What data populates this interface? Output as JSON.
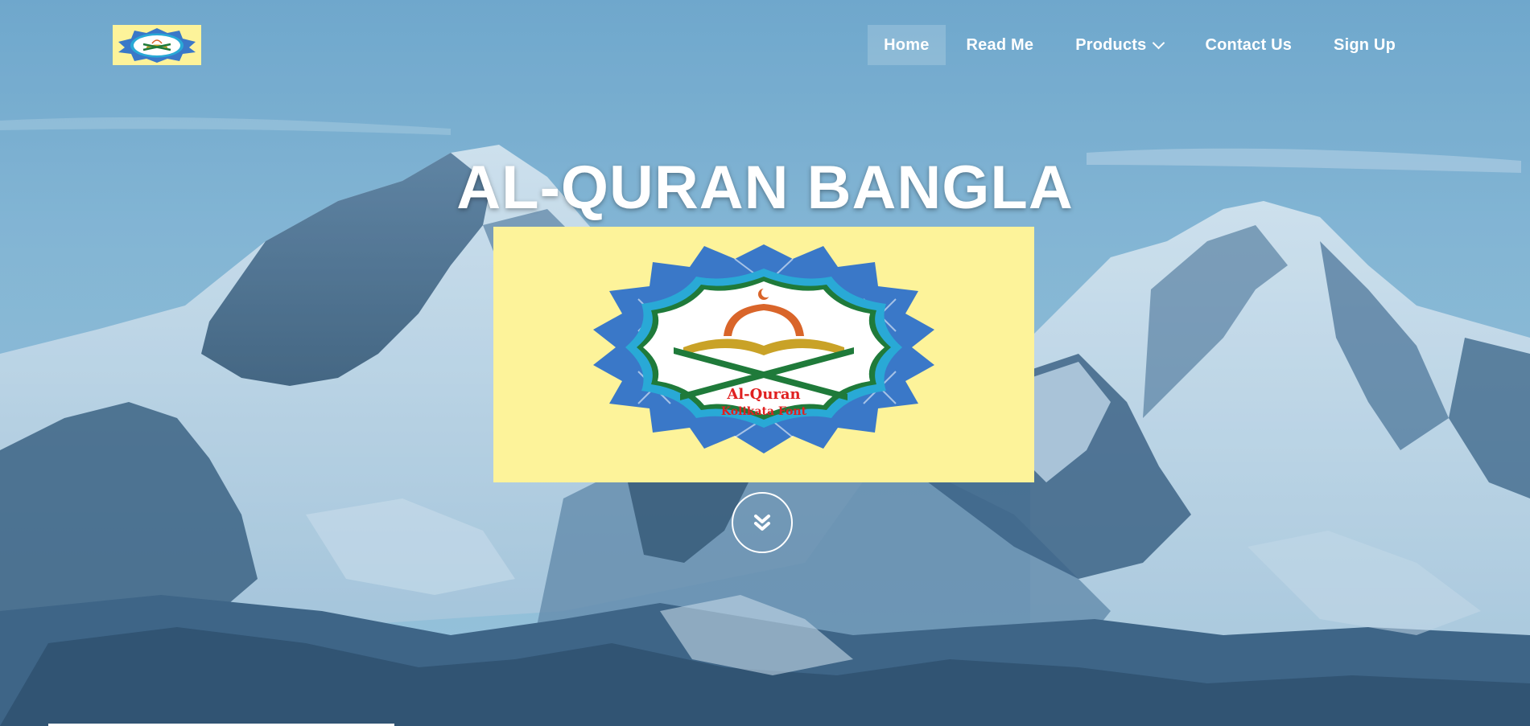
{
  "nav": {
    "items": [
      {
        "label": "Home",
        "active": true
      },
      {
        "label": "Read Me",
        "active": false
      },
      {
        "label": "Products",
        "active": false,
        "has_dropdown": true
      },
      {
        "label": "Contact Us",
        "active": false
      },
      {
        "label": "Sign Up",
        "active": false
      }
    ]
  },
  "hero": {
    "title": "AL-QURAN BANGLA",
    "logo_line1": "Al-Quran",
    "logo_line2": "Kolikata Font",
    "scroll_icon": "double-chevron-down-icon"
  },
  "colors": {
    "logo_bg": "#fdf39a",
    "star_blue": "#3a78c8",
    "ring_cyan": "#29a9d6",
    "book_gold": "#c9a227",
    "book_green": "#1f7a3a",
    "dome_orange": "#d9652a",
    "logo_text_red": "#e02020"
  }
}
